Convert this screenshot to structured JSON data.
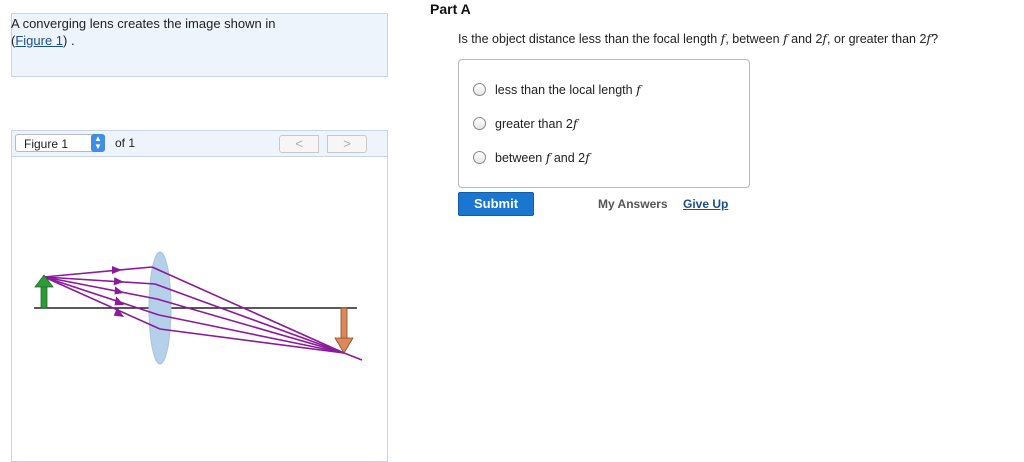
{
  "problem": {
    "text": "A converging lens creates the image shown in",
    "link_open": "(",
    "link": "Figure 1",
    "link_close": ") ."
  },
  "figure": {
    "select_label": "Figure 1",
    "of_label": "of 1",
    "prev": "<",
    "next": ">",
    "colors": {
      "ray": "#8b1a9c",
      "lens": "#b5d0e8",
      "object": "#2e9a3a",
      "image": "#d9895b"
    }
  },
  "part": {
    "title": "Part A",
    "q_pre": "Is the object distance less than the focal length ",
    "q_f1": "f",
    "q_mid": ", between ",
    "q_f2": "f",
    "q_and": " and 2",
    "q_f3": "f",
    "q_post": ", or greater than 2",
    "q_f4": "f",
    "q_end": "?"
  },
  "choices": [
    {
      "text": "less than the local length ",
      "var": "f"
    },
    {
      "text": "greater than 2",
      "var": "f"
    },
    {
      "text": "between ",
      "var": "f",
      "text2": " and 2",
      "var2": "f"
    }
  ],
  "actions": {
    "submit": "Submit",
    "my_answers": "My Answers",
    "give_up": "Give Up"
  }
}
